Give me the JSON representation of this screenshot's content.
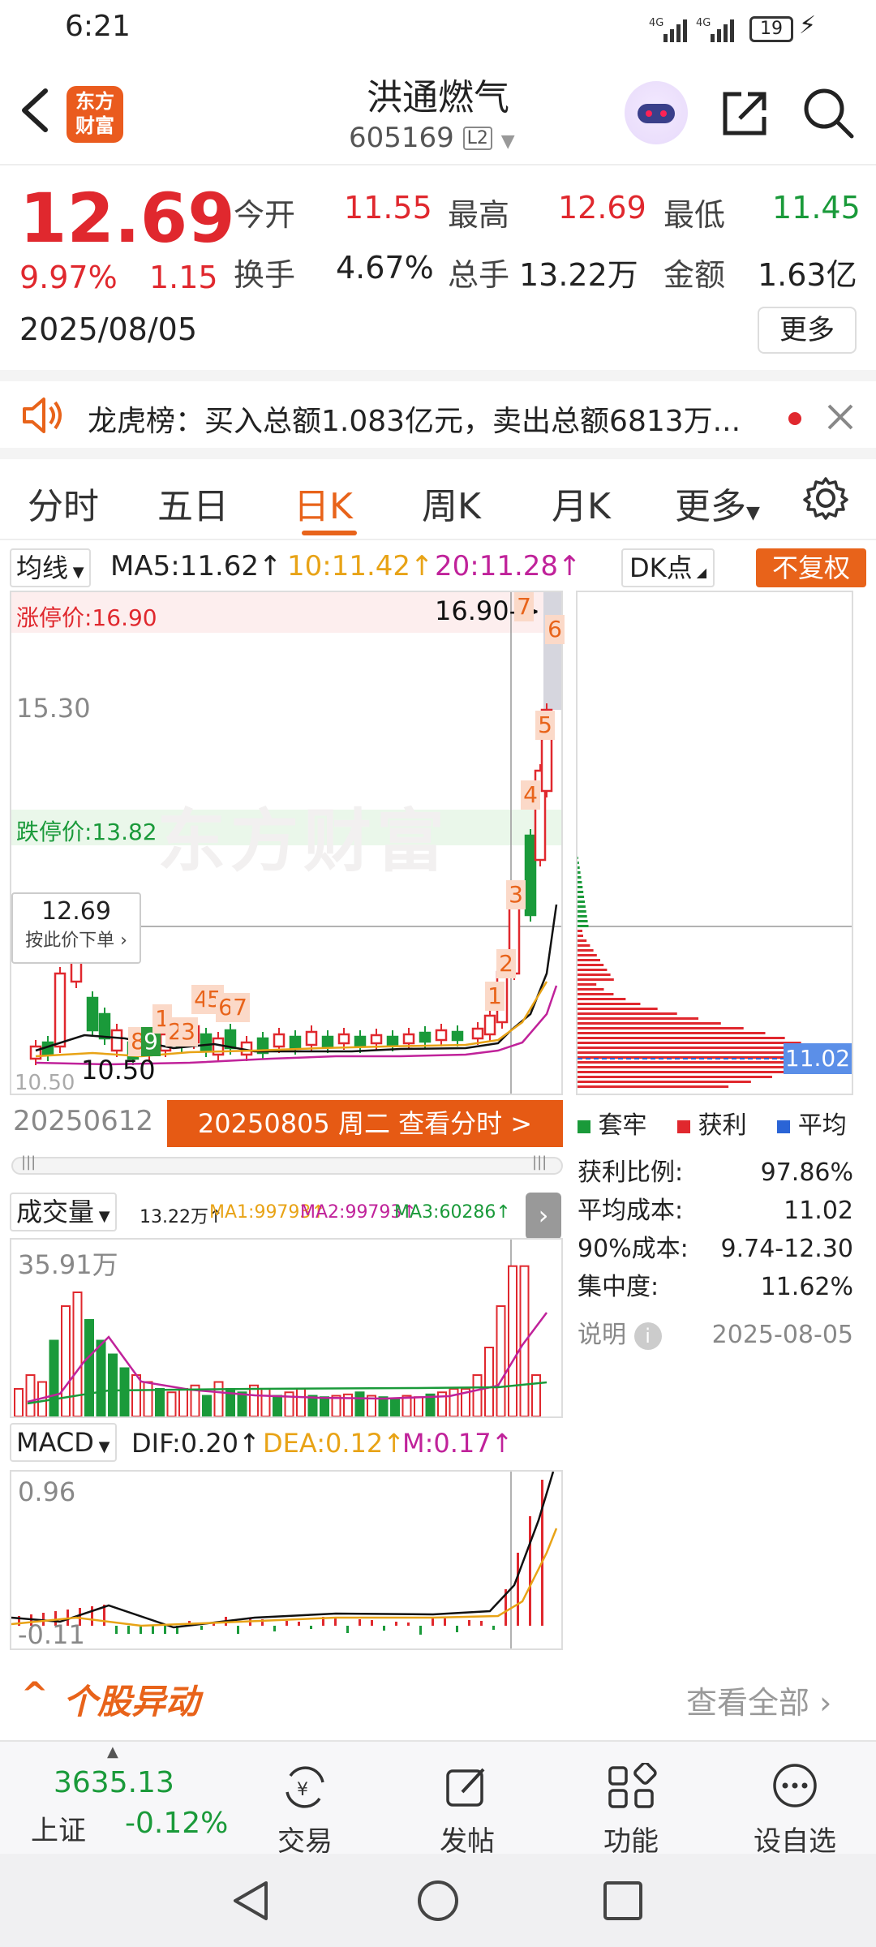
{
  "status": {
    "time": "6:21",
    "signal1": "4G",
    "signal2": "4G",
    "battery": "19"
  },
  "header": {
    "logo_text": "东方\n财富",
    "stock_name": "洪通燃气",
    "stock_code": "605169",
    "level": "L2"
  },
  "quote": {
    "price": "12.69",
    "change_pct": "9.97%",
    "change": "1.15",
    "date": "2025/08/05",
    "open_label": "今开",
    "open": "11.55",
    "high_label": "最高",
    "high": "12.69",
    "low_label": "最低",
    "low": "11.45",
    "turnover_label": "换手",
    "turnover": "4.67%",
    "volume_label": "总手",
    "volume": "13.22万",
    "amount_label": "金额",
    "amount": "1.63亿",
    "more_label": "更多"
  },
  "announcement": {
    "text": "龙虎榜：买入总额1.083亿元，卖出总额6813万..."
  },
  "tabs": [
    "分时",
    "五日",
    "日K",
    "周K",
    "月K",
    "更多"
  ],
  "active_tab": "日K",
  "ma_row": {
    "select": "均线",
    "ma5": "MA5:11.62↑",
    "ma10": "10:11.42↑",
    "ma20": "20:11.28↑",
    "dk": "DK点",
    "fq": "不复权"
  },
  "kchart": {
    "limit_up": "涨停价:16.90",
    "limit_down": "跌停价:13.82",
    "arrow_label": "16.90->",
    "y1": "15.30",
    "price_tag": "12.69",
    "price_tag_sub": "按此价下单",
    "low_label": "10.50",
    "left_label": "10.50",
    "date_left": "20250612",
    "date_btn": "20250805 周二 查看分时 >",
    "watermark": "东方财富",
    "markers": [
      "1",
      "2",
      "3",
      "4",
      "5",
      "6",
      "7",
      "8",
      "9",
      "1",
      "2",
      "3",
      "4",
      "5",
      "6",
      "7",
      "8"
    ]
  },
  "dist": {
    "legend": [
      "套牢",
      "获利",
      "平均"
    ],
    "avg_tag": "11.02",
    "rows": [
      {
        "k": "获利比例:",
        "v": "97.86%"
      },
      {
        "k": "平均成本:",
        "v": "11.02"
      },
      {
        "k": "90%成本:",
        "v": "9.74-12.30"
      },
      {
        "k": "集中度:",
        "v": "11.62%"
      }
    ],
    "note_label": "说明",
    "note_date": "2025-08-05"
  },
  "volume": {
    "select": "成交量",
    "v": "13.22万↑",
    "ma1": "MA1:99793↑",
    "ma2": "MA2:99793↑",
    "ma3": "MA3:60286↑",
    "ymax": "35.91万"
  },
  "macd": {
    "select": "MACD",
    "dif": "DIF:0.20↑",
    "dea": "DEA:0.12↑",
    "m": "M:0.17↑",
    "ymax": "0.96",
    "ymin": "-0.11"
  },
  "section": {
    "title": "个股异动",
    "link": "查看全部"
  },
  "bottom_nav": {
    "index_value": "3635.13",
    "index_name": "上证",
    "index_change": "-0.12%",
    "items": [
      "交易",
      "发帖",
      "功能",
      "设自选"
    ]
  },
  "colors": {
    "red": "#e0282e",
    "green": "#1a9a3a",
    "orange": "#e8631a"
  }
}
